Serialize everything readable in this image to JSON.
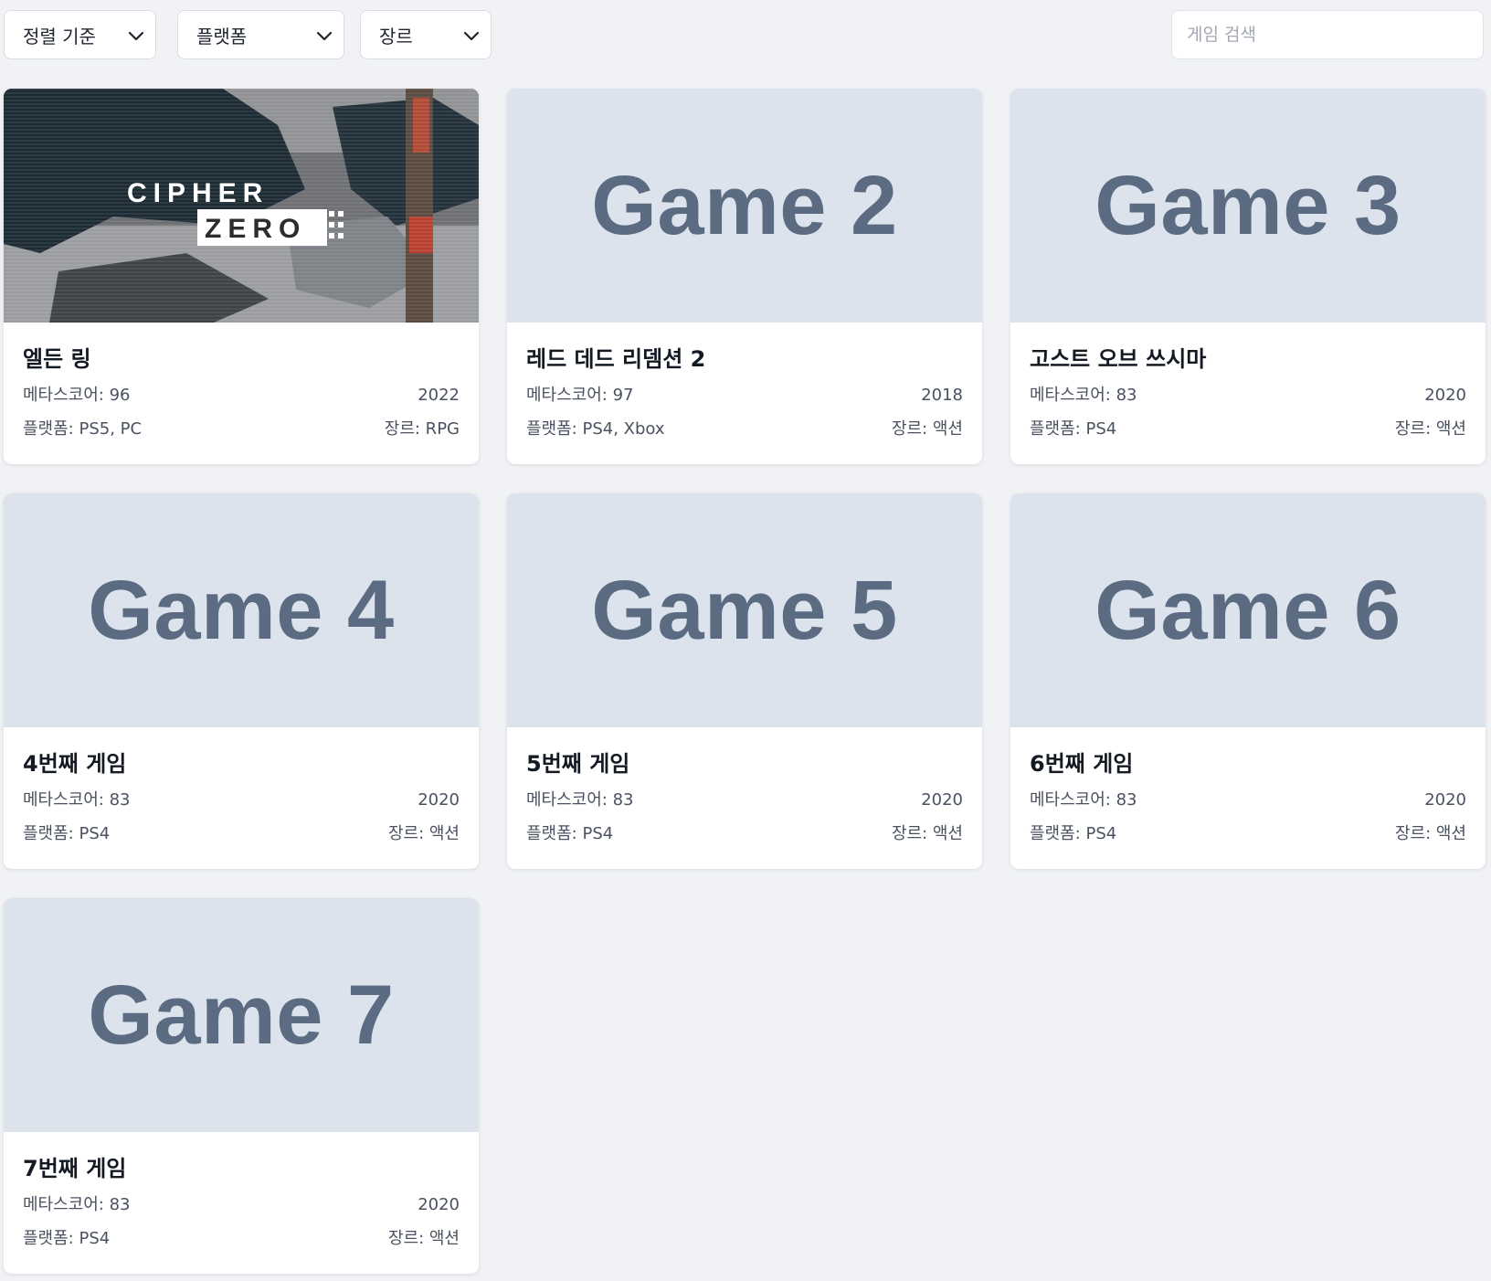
{
  "filters": {
    "sort_label": "정렬 기준",
    "platform_label": "플랫폼",
    "genre_label": "장르"
  },
  "search": {
    "placeholder": "게임 검색",
    "value": ""
  },
  "games": [
    {
      "title": "엘든 링",
      "thumb": "",
      "art_text_1": "CIPHER",
      "art_text_2": "ZERO",
      "score": "메타스코어: 96",
      "year": "2022",
      "platform": "플랫폼: PS5, PC",
      "genre": "장르: RPG"
    },
    {
      "title": "레드 데드 리뎀션 2",
      "thumb": "Game 2",
      "score": "메타스코어: 97",
      "year": "2018",
      "platform": "플랫폼: PS4, Xbox",
      "genre": "장르: 액션"
    },
    {
      "title": "고스트 오브 쓰시마",
      "thumb": "Game 3",
      "score": "메타스코어: 83",
      "year": "2020",
      "platform": "플랫폼: PS4",
      "genre": "장르: 액션"
    },
    {
      "title": "4번째 게임",
      "thumb": "Game 4",
      "score": "메타스코어: 83",
      "year": "2020",
      "platform": "플랫폼: PS4",
      "genre": "장르: 액션"
    },
    {
      "title": "5번째 게임",
      "thumb": "Game 5",
      "score": "메타스코어: 83",
      "year": "2020",
      "platform": "플랫폼: PS4",
      "genre": "장르: 액션"
    },
    {
      "title": "6번째 게임",
      "thumb": "Game 6",
      "score": "메타스코어: 83",
      "year": "2020",
      "platform": "플랫폼: PS4",
      "genre": "장르: 액션"
    },
    {
      "title": "7번째 게임",
      "thumb": "Game 7",
      "score": "메타스코어: 83",
      "year": "2020",
      "platform": "플랫폼: PS4",
      "genre": "장르: 액션"
    }
  ]
}
